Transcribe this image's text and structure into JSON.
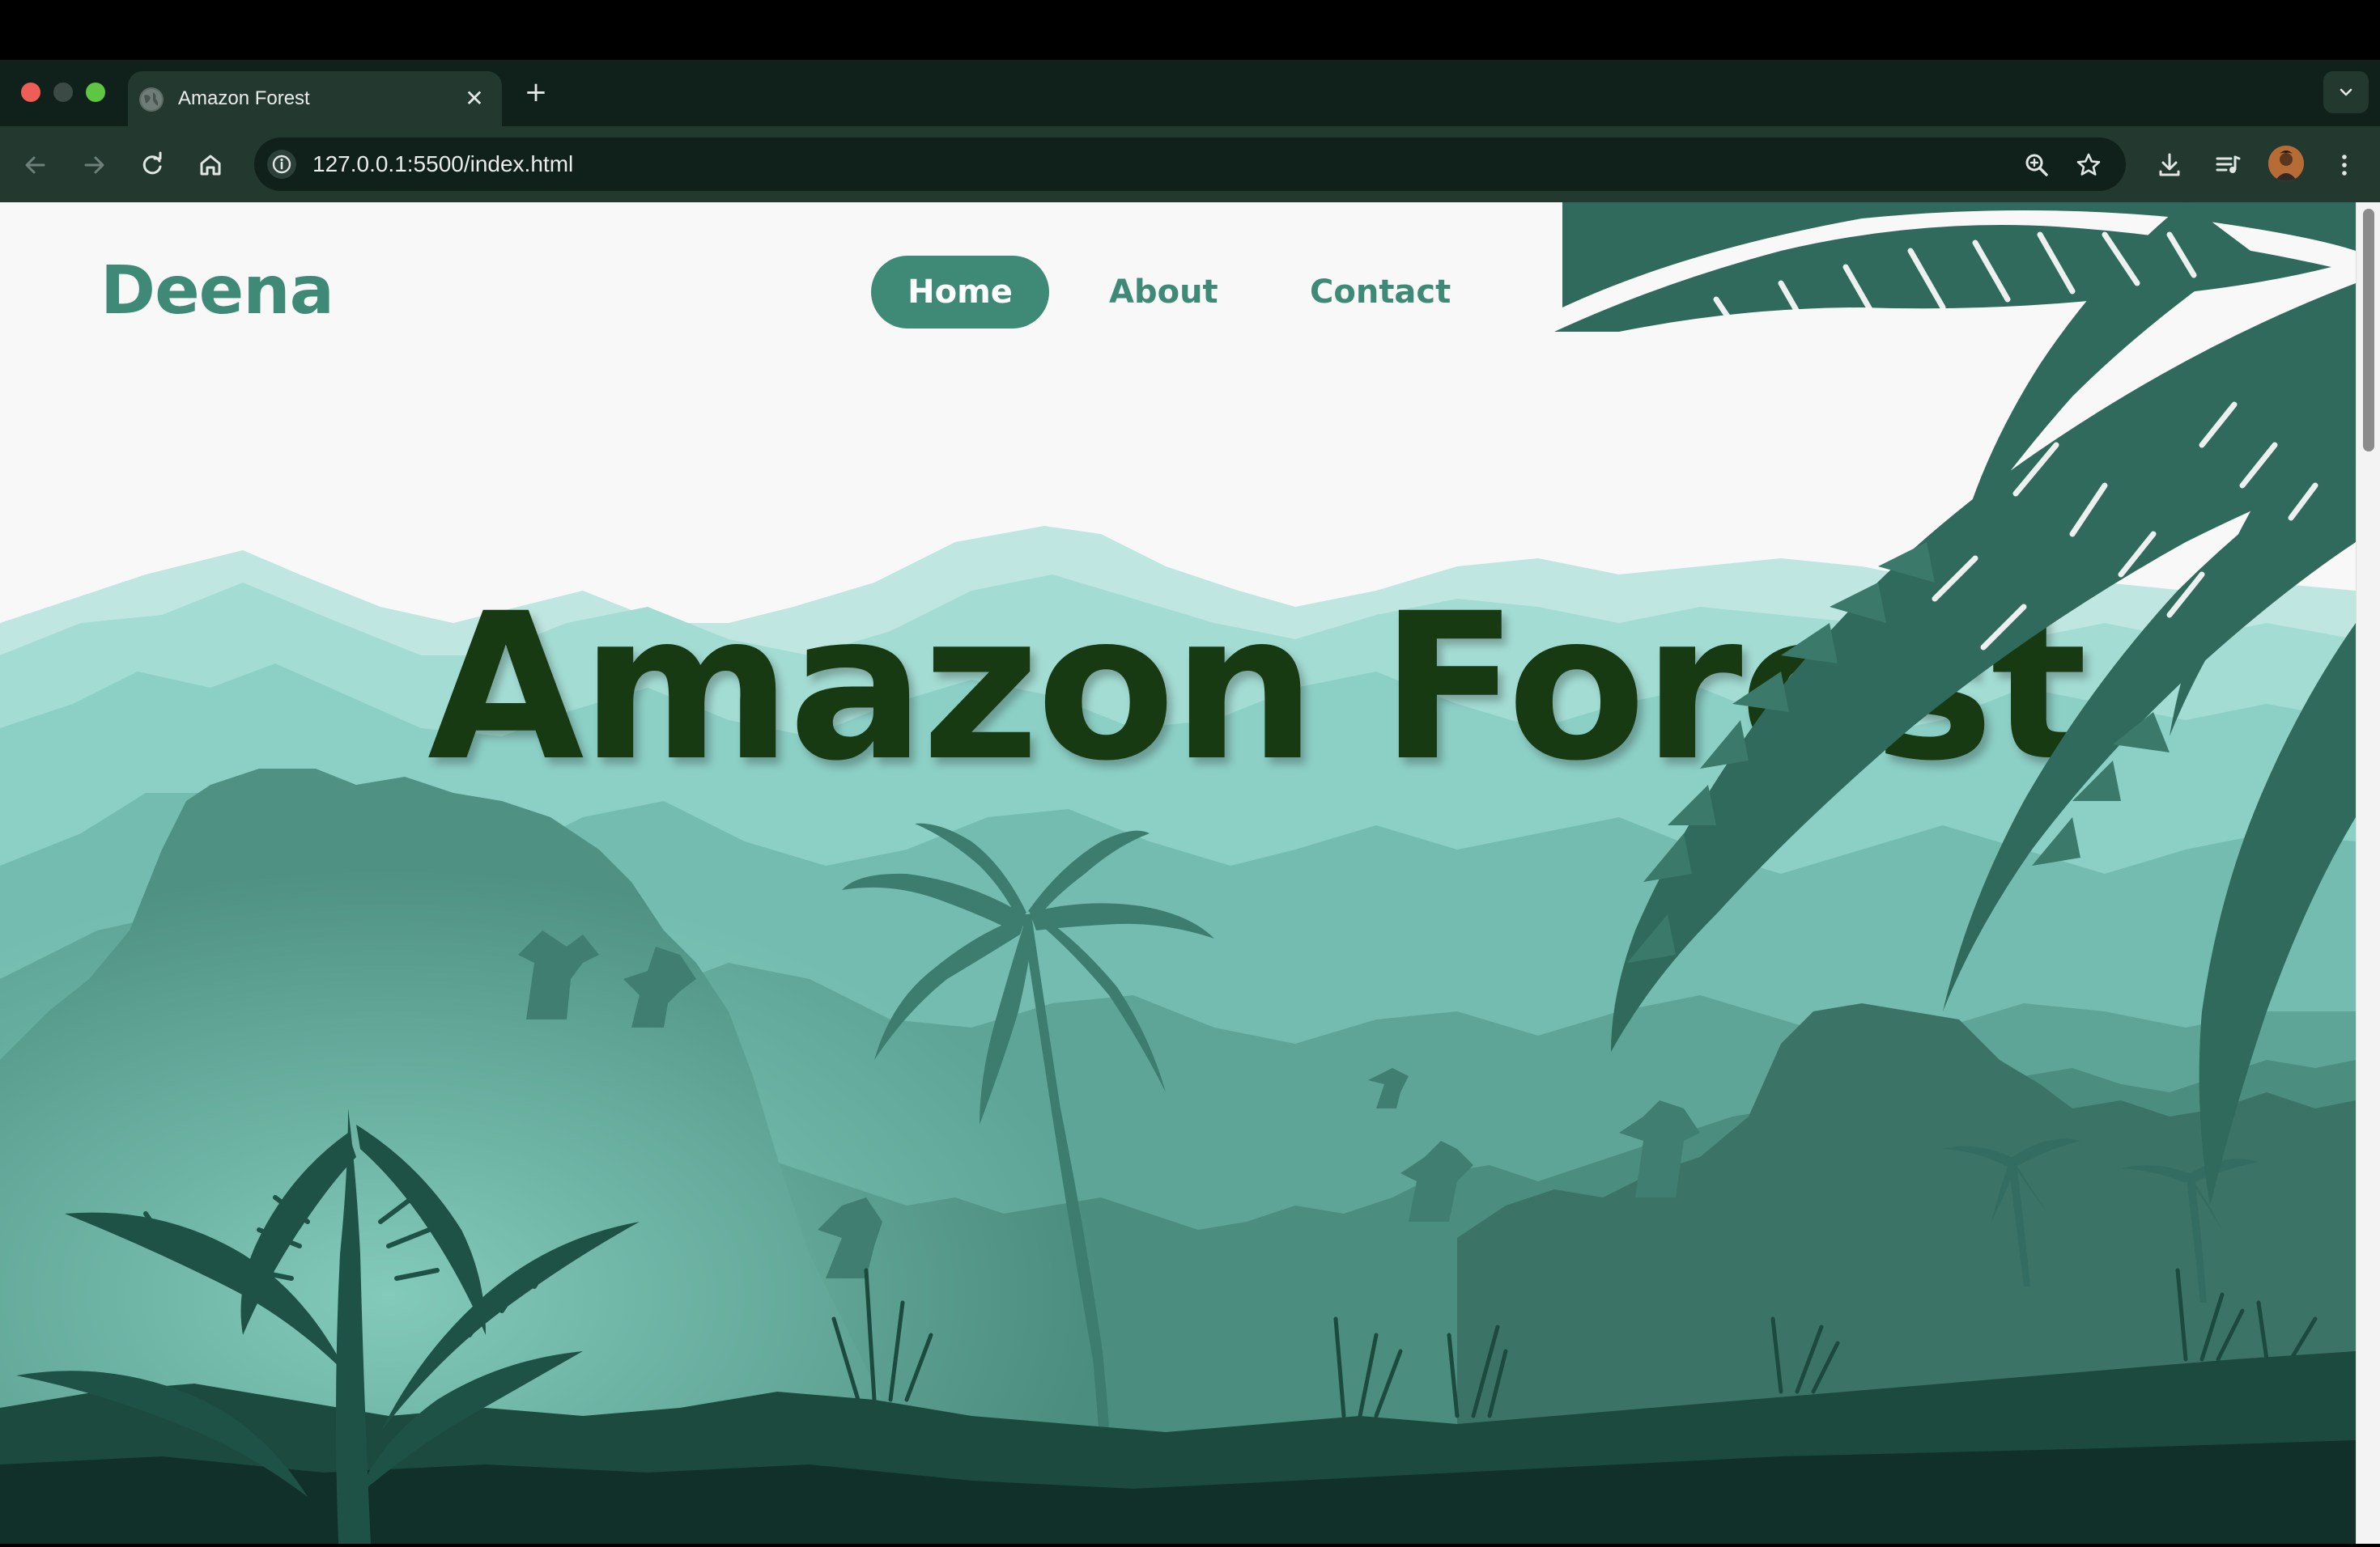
{
  "browser": {
    "tab_title": "Amazon Forest",
    "tab_close": "✕",
    "new_tab": "+",
    "url": "127.0.0.1:5500/index.html"
  },
  "icons": {
    "back": "arrow-left-icon",
    "forward": "arrow-right-icon",
    "reload": "reload-icon",
    "home": "home-icon",
    "site_info": "info-icon",
    "zoom": "zoom-icon",
    "bookmark": "star-icon",
    "download": "download-icon",
    "media": "media-control-icon",
    "menu": "kebab-menu-icon",
    "tab_search": "chevron-down-icon"
  },
  "site": {
    "logo": "Deena",
    "nav": {
      "home": "Home",
      "about": "About",
      "contact": "Contact"
    },
    "hero_title": "Amazon Forest"
  },
  "colors": {
    "brand": "#3e8a77",
    "title": "#173a12",
    "chrome_bg": "#10201b",
    "chrome_toolbar": "#23382f"
  }
}
